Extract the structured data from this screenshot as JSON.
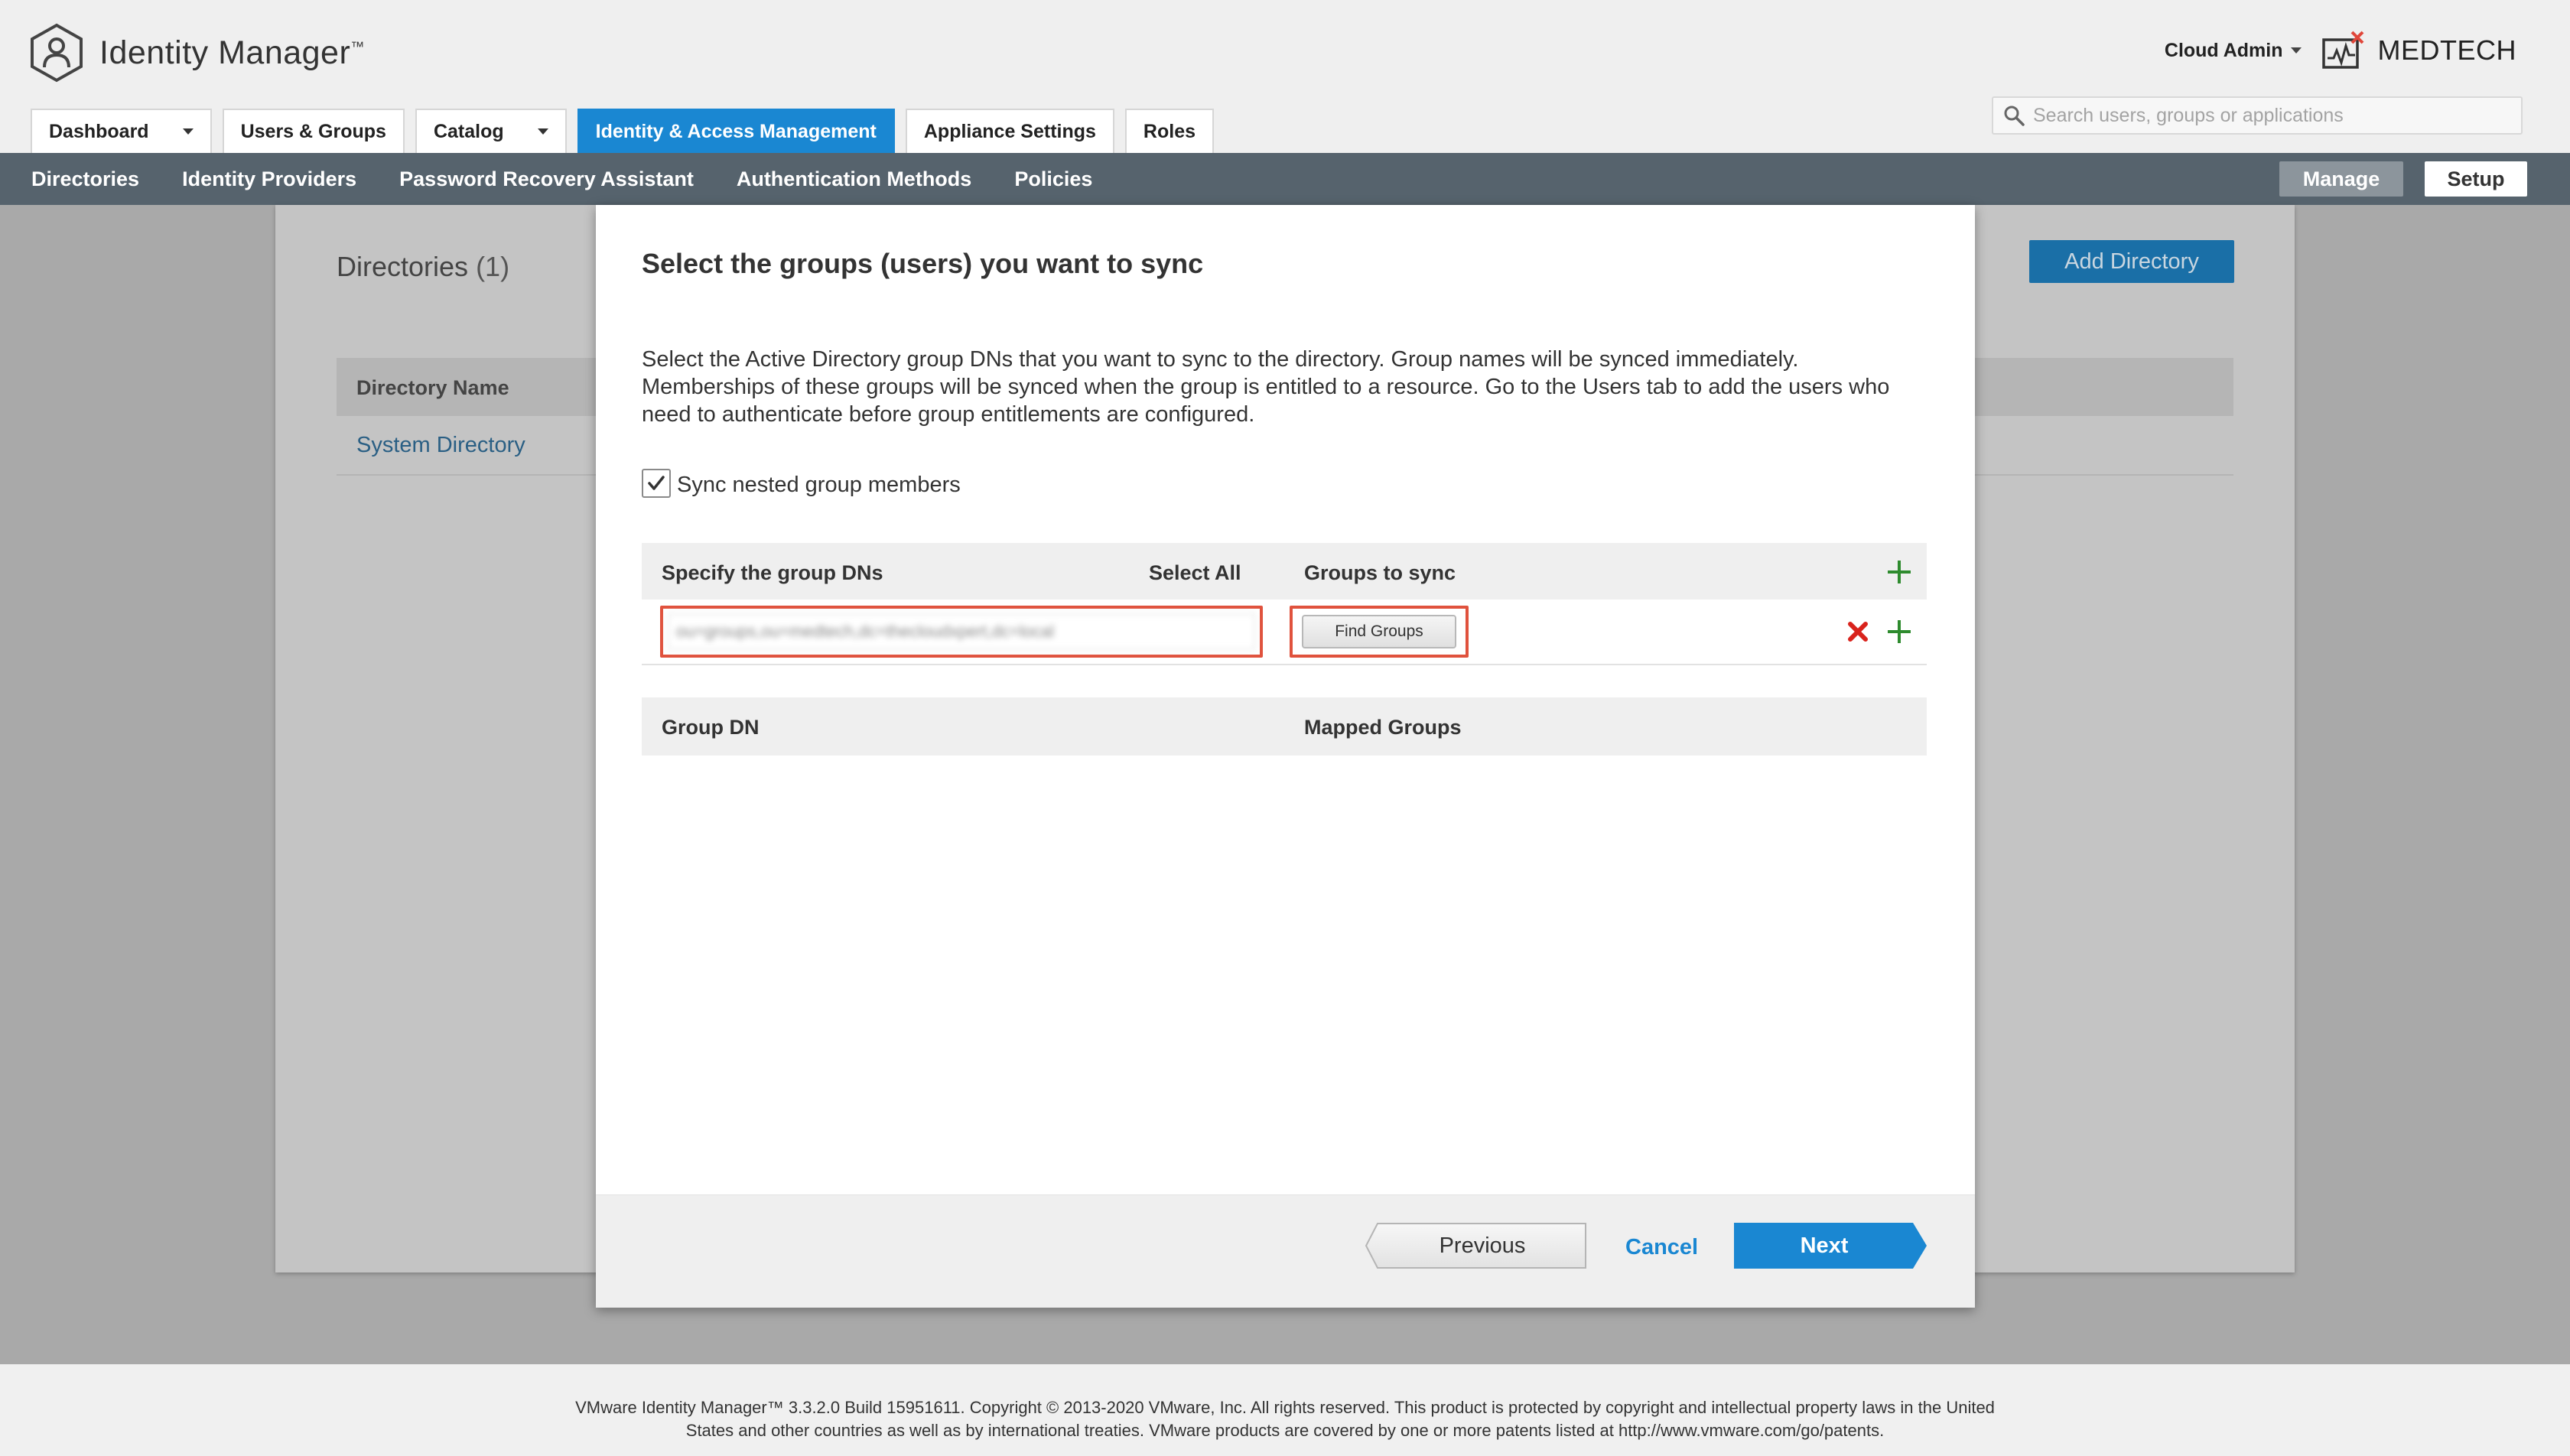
{
  "app": {
    "name": "Identity Manager",
    "trademark": "™"
  },
  "user": {
    "name": "Cloud Admin",
    "org": "MEDTECH"
  },
  "search": {
    "placeholder": "Search users, groups or applications"
  },
  "tabs": [
    {
      "label": "Dashboard",
      "has_dropdown": true,
      "active": false
    },
    {
      "label": "Users & Groups",
      "has_dropdown": false,
      "active": false
    },
    {
      "label": "Catalog",
      "has_dropdown": true,
      "active": false
    },
    {
      "label": "Identity & Access Management",
      "has_dropdown": false,
      "active": true
    },
    {
      "label": "Appliance Settings",
      "has_dropdown": false,
      "active": false
    },
    {
      "label": "Roles",
      "has_dropdown": false,
      "active": false
    }
  ],
  "subnav": {
    "items": [
      "Directories",
      "Identity Providers",
      "Password Recovery Assistant",
      "Authentication Methods",
      "Policies"
    ],
    "manage_label": "Manage",
    "setup_label": "Setup"
  },
  "background_page": {
    "title": "Directories",
    "count": "(1)",
    "add_button": "Add Directory",
    "column_header": "Directory Name",
    "row": "System Directory"
  },
  "modal": {
    "title": "Select the groups (users) you want to sync",
    "description": "Select the Active Directory group DNs that you want to sync to the directory. Group names will be synced immediately. Memberships of these groups will be synced when the group is entitled to a resource. Go to the Users tab to add the users who need to authenticate before group entitlements are configured.",
    "sync_nested_label": "Sync nested group members",
    "sync_nested_checked": true,
    "grid": {
      "col_dn": "Specify the group DNs",
      "col_select_all": "Select All",
      "col_groups": "Groups to sync",
      "dn_value": "ou=groups,ou=medtech,dc=thecloudxpert,dc=local",
      "find_groups": "Find Groups"
    },
    "mapping": {
      "col_group_dn": "Group DN",
      "col_mapped": "Mapped Groups"
    },
    "footer": {
      "previous": "Previous",
      "cancel": "Cancel",
      "next": "Next"
    }
  },
  "colors": {
    "accent": "#1a87d2",
    "subnav_bg": "#56636d",
    "highlight_box": "#e0523d",
    "add_icon": "#2e8b2e",
    "remove_icon": "#d9231c"
  },
  "footer": {
    "line1": "VMware Identity Manager™ 3.3.2.0 Build 15951611. Copyright © 2013-2020 VMware, Inc. All rights reserved. This product is protected by copyright and intellectual property laws in the United",
    "line2": "States and other countries as well as by international treaties. VMware products are covered by one or more patents listed at http://www.vmware.com/go/patents."
  }
}
